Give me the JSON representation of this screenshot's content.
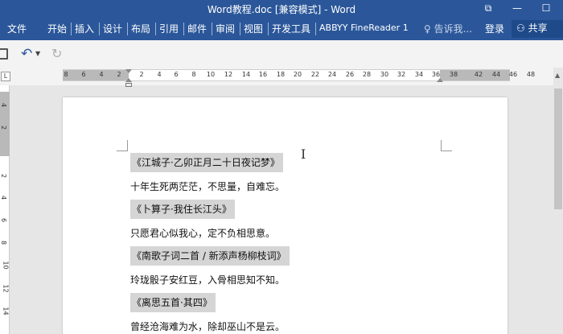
{
  "window": {
    "title": "Word教程.doc [兼容模式] - Word"
  },
  "tabs": [
    "文件",
    "开始",
    "插入",
    "设计",
    "布局",
    "引用",
    "邮件",
    "审阅",
    "视图",
    "开发工具",
    "ABBYY FineReader 1"
  ],
  "tell_me": "告诉我...",
  "login_label": "登录",
  "share_label": "共享",
  "quick_access": {
    "save_icon": "save-icon",
    "undo_icon": "undo-icon",
    "redo_icon": "redo-icon"
  },
  "ruler": {
    "corner_label": "L",
    "horizontal_ticks": [
      "8",
      "6",
      "4",
      "2",
      "2",
      "4",
      "6",
      "8",
      "10",
      "12",
      "14",
      "16",
      "18",
      "20",
      "22",
      "24",
      "26",
      "28",
      "30",
      "32",
      "34",
      "36",
      "38",
      "42",
      "44",
      "46",
      "48"
    ],
    "vertical_ticks": [
      "4",
      "2",
      "2",
      "4",
      "6",
      "8",
      "10",
      "12",
      "14"
    ]
  },
  "document": {
    "lines": [
      {
        "text": "《江城子·乙卯正月二十日夜记梦》",
        "shaded": true
      },
      {
        "text": "十年生死两茫茫，不思量，自难忘。",
        "shaded": false
      },
      {
        "text": "《卜算子·我住长江头》",
        "shaded": true
      },
      {
        "text": "只愿君心似我心，定不负相思意。",
        "shaded": false
      },
      {
        "text": "《南歌子词二首 / 新添声杨柳枝词》",
        "shaded": true
      },
      {
        "text": "玲珑骰子安红豆，入骨相思知不知。",
        "shaded": false
      },
      {
        "text": "《离思五首·其四》",
        "shaded": true
      },
      {
        "text": "曾经沧海难为水，除却巫山不是云。",
        "shaded": false
      }
    ]
  },
  "colors": {
    "ribbon": "#2b579a",
    "shade": "#d5d5d5"
  }
}
